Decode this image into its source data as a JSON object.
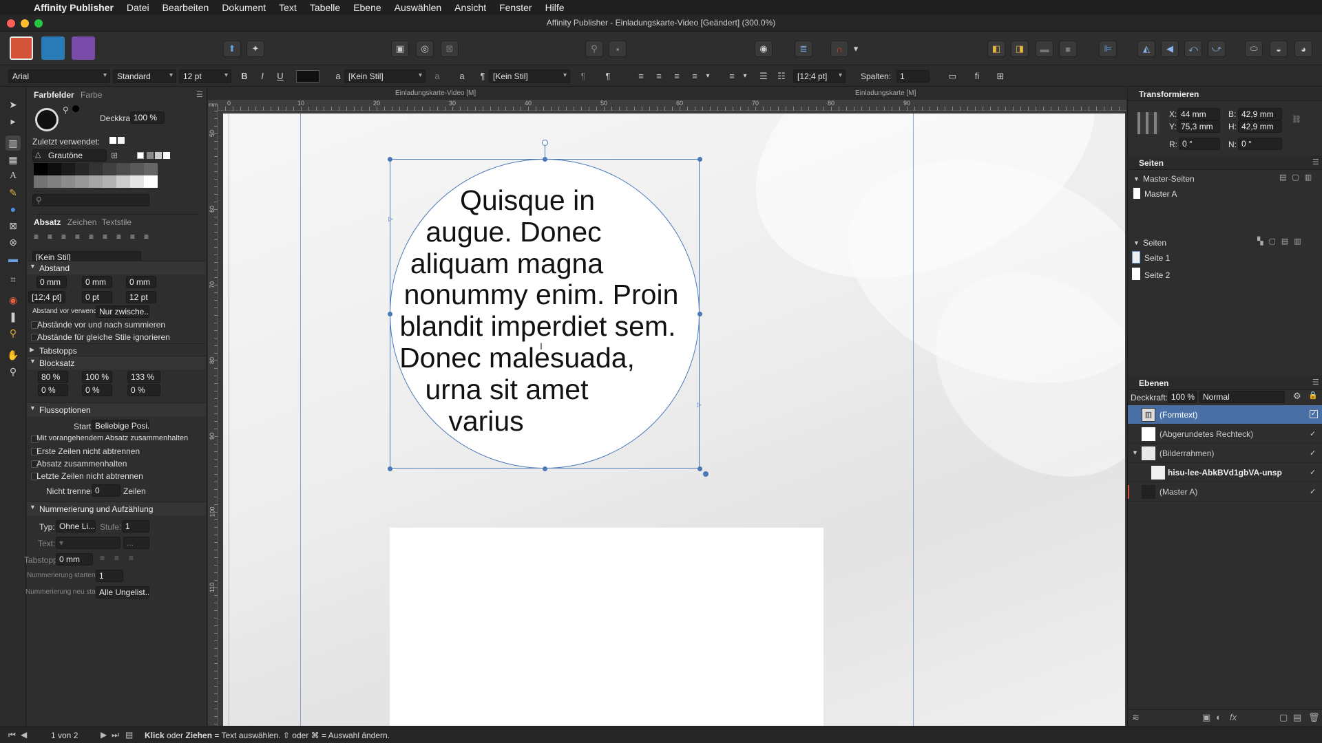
{
  "menubar": {
    "apple": "",
    "app": "Affinity Publisher",
    "items": [
      "Datei",
      "Bearbeiten",
      "Dokument",
      "Text",
      "Tabelle",
      "Ebene",
      "Auswählen",
      "Ansicht",
      "Fenster",
      "Hilfe"
    ]
  },
  "window": {
    "title": "Affinity Publisher - Einladungskarte-Video [Geändert] (300.0%)"
  },
  "context": {
    "font": "Arial",
    "style": "Standard",
    "size": "12 pt",
    "char_style": "[Kein Stil]",
    "para_style": "[Kein Stil]",
    "leading": "[12;4 pt]",
    "columns_label": "Spalten:",
    "columns_value": "1",
    "bold": "B",
    "italic": "I",
    "underline": "U"
  },
  "left": {
    "tab_swatches": "Farbfelder",
    "tab_color": "Farbe",
    "opacity_label": "Deckkraft:",
    "opacity_value": "100 %",
    "recent_label": "Zuletzt verwendet:",
    "palette": "Grautöne",
    "tab_para": "Absatz",
    "tab_char": "Zeichen",
    "tab_textstyles": "Textstile",
    "para_style": "[Kein Stil]",
    "sec_spacing": "Abstand",
    "sp_left": "0 mm",
    "sp_right": "0 mm",
    "sp_first": "0 mm",
    "sp_leading": "[12;4 pt]",
    "sp_before": "0 pt",
    "sp_after": "12 pt",
    "space_before_label": "Abstand vor verwenden:",
    "space_before_value": "Nur zwische...",
    "cb_sum": "Abstände vor und nach summieren",
    "cb_ignore": "Abstände für gleiche Stile ignorieren",
    "sec_tabs": "Tabstopps",
    "sec_justify": "Blocksatz",
    "j_word": "80 %",
    "j_letter": "100 %",
    "j_glyph": "133 %",
    "j_a": "0 %",
    "j_b": "0 %",
    "j_c": "0 %",
    "sec_flow": "Flussoptionen",
    "start_label": "Start:",
    "start_value": "Beliebige Posi...",
    "cb_keep_prev": "Mit vorangehendem Absatz zusammenhalten",
    "cb_first_lines": "Erste Zeilen nicht abtrennen",
    "cb_keep_together": "Absatz zusammenhalten",
    "cb_last_lines": "Letzte Zeilen nicht abtrennen",
    "nobreak_label": "Nicht trennen:",
    "nobreak_value": "0",
    "nobreak_unit": "Zeilen",
    "sec_numbering": "Nummerierung und Aufzählung",
    "type_label": "Typ:",
    "type_value": "Ohne Li...",
    "level_label": "Stufe:",
    "level_value": "1",
    "text_label": "Text:",
    "tabstop_label": "Tabstopp:",
    "tabstop_value": "0 mm",
    "start_at_label": "Nummerierung starten bei:",
    "start_at_value": "1",
    "restart_label": "Nummerierung neu starten:",
    "restart_value": "Alle Ungelist..."
  },
  "canvas": {
    "doc_tab_1": "Einladungskarte-Video [M]",
    "doc_tab_2": "Einladungskarte [M]",
    "ruler_unit": "mm",
    "ruler_h": [
      "0",
      "10",
      "20",
      "30",
      "40",
      "50",
      "60",
      "70",
      "80",
      "90"
    ],
    "ruler_v": [
      "50",
      "60",
      "70",
      "80",
      "90",
      "100",
      "110"
    ],
    "text_lines": [
      "Quisque in",
      "augue. Donec",
      "aliquam magna",
      "nonummy enim. Proin",
      "blandit imperdiet sem.",
      "Donec malesuada,",
      "urna sit amet",
      "varius"
    ]
  },
  "right": {
    "transform_title": "Transformieren",
    "x_label": "X:",
    "x_value": "44 mm",
    "y_label": "Y:",
    "y_value": "75,3 mm",
    "b_label": "B:",
    "b_value": "42,9 mm",
    "h_label": "H:",
    "h_value": "42,9 mm",
    "r_label": "R:",
    "r_value": "0 °",
    "n_label": "N:",
    "n_value": "0 °",
    "pages_title": "Seiten",
    "master_title": "Master-Seiten",
    "master_a": "Master A",
    "pages_sub": "Seiten",
    "page1": "Seite 1",
    "page2": "Seite 2",
    "layers_title": "Ebenen",
    "layers_opacity_label": "Deckkraft:",
    "layers_opacity_value": "100 %",
    "blend": "Normal",
    "layers": [
      "(Formtext)",
      "(Abgerundetes Rechteck)",
      "(Bilderrahmen)",
      "hisu-lee-AbkBVd1gbVA-unsp",
      "(Master A)"
    ]
  },
  "status": {
    "pages": "1 von 2",
    "hint_bold1": "Klick",
    "hint_mid1": " oder ",
    "hint_bold2": "Ziehen",
    "hint_rest": " = Text auswählen. ⇧ oder ⌘ = Auswahl ändern."
  },
  "colors": {
    "accent": "#4a78b8",
    "selection": "#3f6fb0",
    "persona_publisher": "#d4543a",
    "persona_designer": "#2a7ab8",
    "persona_photo": "#7a4aa8"
  }
}
